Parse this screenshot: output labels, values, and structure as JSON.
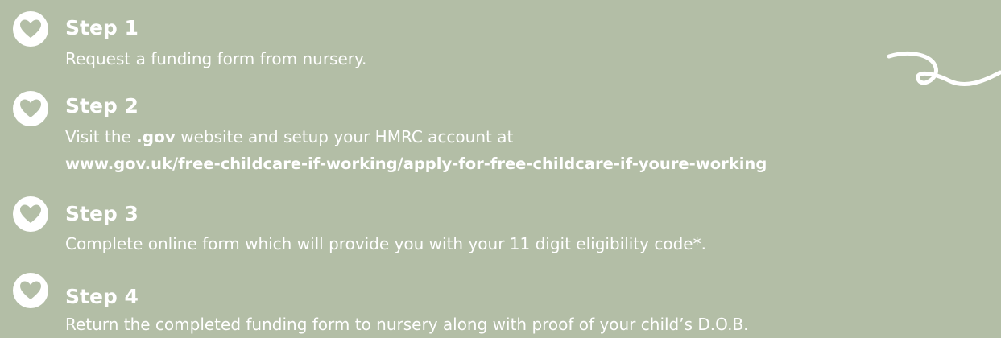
{
  "steps": [
    {
      "title": "Step 1",
      "text": "Request a funding form from nursery.",
      "icon": "heart-icon"
    },
    {
      "title": "Step 2",
      "text_before": "Visit the ",
      "text_bold": ".gov",
      "text_after": " website and setup your HMRC account at",
      "link": "www.gov.uk/free-childcare-if-working/apply-for-free-childcare-if-youre-working",
      "icon": "heart-icon"
    },
    {
      "title": "Step 3",
      "text": "Complete online form which will provide you with your 11 digit eligibility code*.",
      "icon": "heart-icon"
    },
    {
      "title": "Step 4",
      "text": "Return the completed funding form to nursery along with proof of your child’s D.O.B.",
      "icon": "heart-icon"
    }
  ],
  "colors": {
    "background": "#b3bea6",
    "text": "#ffffff",
    "heart": "#b3bea6"
  },
  "decoration": {
    "icon": "squiggle-icon"
  }
}
